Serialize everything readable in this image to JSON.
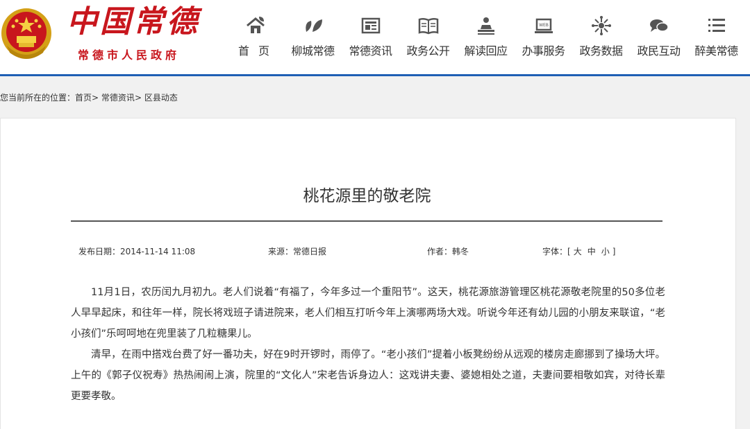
{
  "header": {
    "logo_main": "中国常德",
    "logo_sub": "常德市人民政府",
    "nav": [
      {
        "label": "首 页",
        "icon": "home-icon"
      },
      {
        "label": "柳城常德",
        "icon": "leaf-icon"
      },
      {
        "label": "常德资讯",
        "icon": "news-icon"
      },
      {
        "label": "政务公开",
        "icon": "book-icon"
      },
      {
        "label": "解读回应",
        "icon": "podium-icon"
      },
      {
        "label": "办事服务",
        "icon": "web-icon"
      },
      {
        "label": "政务数据",
        "icon": "data-icon"
      },
      {
        "label": "政民互动",
        "icon": "chat-icon"
      },
      {
        "label": "醉美常德",
        "icon": "menu-icon"
      }
    ]
  },
  "breadcrumb": {
    "prefix": "您当前所在的位置：",
    "items": [
      "首页",
      "常德资讯",
      "区县动态"
    ],
    "sep": ">"
  },
  "article": {
    "title": "桃花源里的敬老院",
    "date": "发布日期：2014-11-14 11:08",
    "source": "来源：常德日报",
    "author": "作者：韩冬",
    "font_label": "字体：[",
    "font_close": "]",
    "font_sizes": [
      "大",
      "中",
      "小"
    ],
    "paragraphs": [
      "11月1日，农历闰九月初九。老人们说着“有福了，今年多过一个重阳节”。这天，桃花源旅游管理区桃花源敬老院里的50多位老人早早起床，和往年一样，院长将戏班子请进院来，老人们相互打听今年上演哪两场大戏。听说今年还有幼儿园的小朋友来联谊，“老小孩们”乐呵呵地在兜里装了几粒糖果儿。",
      "清早，在雨中搭戏台费了好一番功夫，好在9时开锣时，雨停了。“老小孩们”提着小板凳纷纷从远观的楼房走廊挪到了操场大坪。上午的《郭子仪祝寿》热热闹闹上演，院里的“文化人”宋老告诉身边人：这戏讲夫妻、婆媳相处之道，夫妻间要相敬如宾，对待长辈更要孝敬。"
    ]
  }
}
